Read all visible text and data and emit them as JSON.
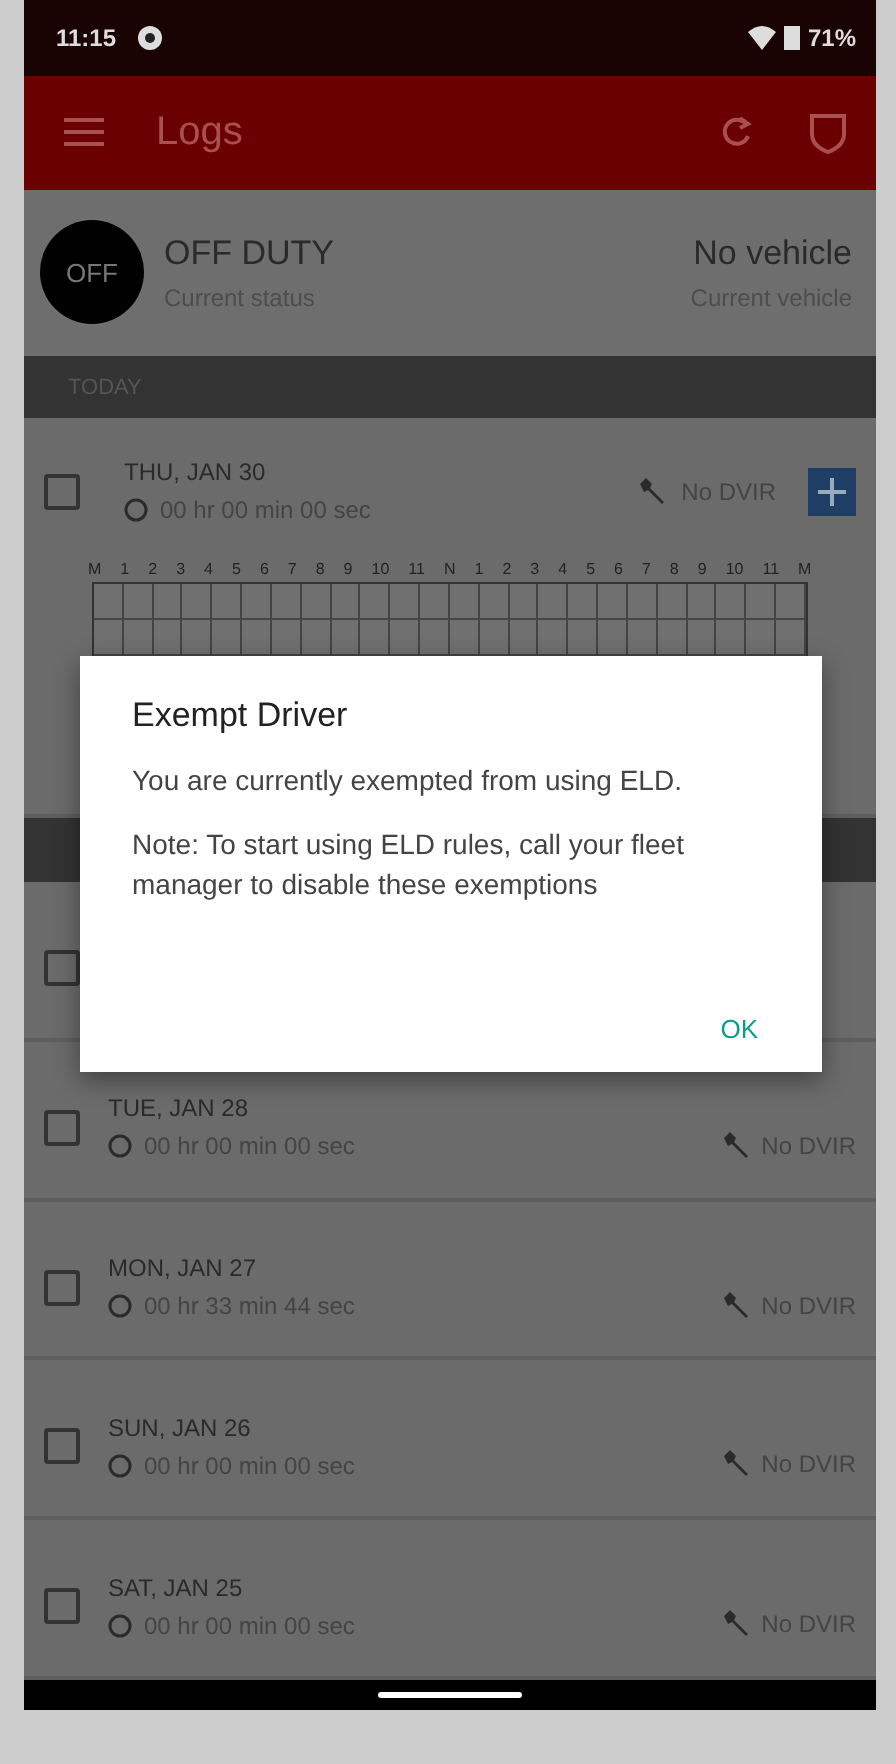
{
  "status_bar": {
    "time": "11:15",
    "battery": "71%"
  },
  "app_bar": {
    "title": "Logs"
  },
  "current": {
    "badge": "OFF",
    "status": "OFF DUTY",
    "status_label": "Current status",
    "vehicle": "No vehicle",
    "vehicle_label": "Current vehicle"
  },
  "today": {
    "header": "TODAY",
    "date": "THU, JAN 30",
    "duration": "00 hr 00 min 00 sec",
    "dvir": "No DVIR",
    "checked": false,
    "hours": [
      "M",
      "1",
      "2",
      "3",
      "4",
      "5",
      "6",
      "7",
      "8",
      "9",
      "10",
      "11",
      "N",
      "1",
      "2",
      "3",
      "4",
      "5",
      "6",
      "7",
      "8",
      "9",
      "10",
      "11",
      "M"
    ]
  },
  "history": [
    {
      "kind": "hidden",
      "checked": false
    },
    {
      "kind": "day",
      "date": "TUE, JAN 28",
      "duration": "00 hr 00 min 00 sec",
      "dvir": "No DVIR",
      "checked": false
    },
    {
      "kind": "day",
      "date": "MON, JAN 27",
      "duration": "00 hr 33 min 44 sec",
      "dvir": "No DVIR",
      "checked": false
    },
    {
      "kind": "day",
      "date": "SUN, JAN 26",
      "duration": "00 hr 00 min 00 sec",
      "dvir": "No DVIR",
      "checked": false
    },
    {
      "kind": "day",
      "date": "SAT, JAN 25",
      "duration": "00 hr 00 min 00 sec",
      "dvir": "No DVIR",
      "checked": false
    }
  ],
  "dialog": {
    "title": "Exempt Driver",
    "message": "You are currently exempted from using ELD.",
    "note": "Note: To start using ELD rules, call your fleet manager to disable these exemptions",
    "button": "OK"
  }
}
